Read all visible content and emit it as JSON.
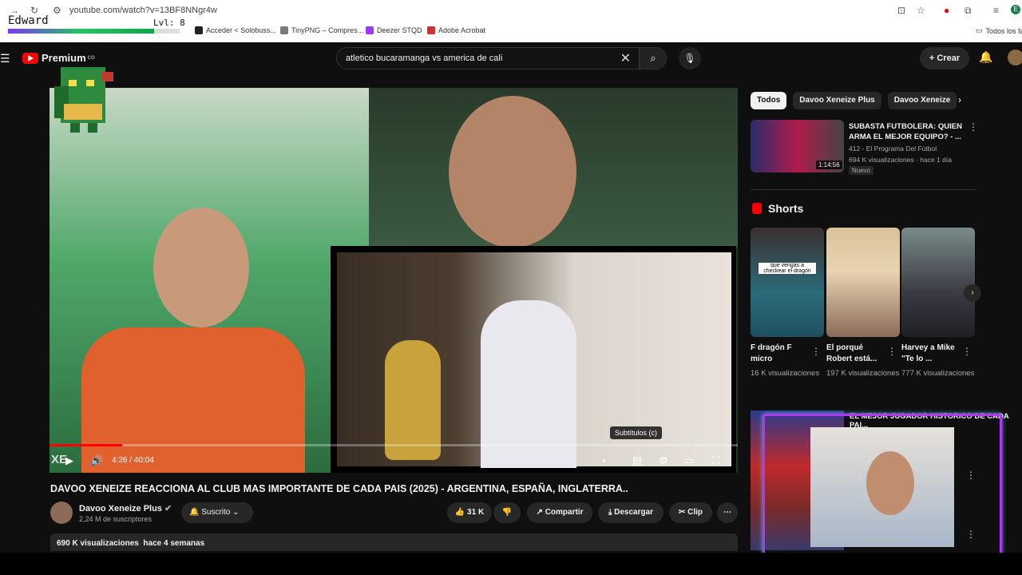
{
  "browser": {
    "url": "youtube.com/watch?v=13BF8NNgr4w",
    "bookmarks": [
      {
        "label": "Acceder < Solobuss...",
        "color": "#222222"
      },
      {
        "label": "TinyPNG – Compres...",
        "color": "#7a7a7a"
      },
      {
        "label": "Deezer STQD",
        "color": "#a238ff"
      },
      {
        "label": "Adobe Acrobat",
        "color": "#d32f2f"
      }
    ],
    "all_bookmarks": "Todos los fa"
  },
  "overlay": {
    "name": "Edward",
    "level": "Lvl: 8",
    "xp_fraction": 0.85
  },
  "header": {
    "logo": "Premium",
    "logo_sup": "CO",
    "search_value": "atletico bucaramanga vs america de cali",
    "create_label": "Crear"
  },
  "player": {
    "time": "4:26 / 40:04",
    "progress_fraction": 0.106,
    "tooltip": "Subtítulos (c)",
    "corner_text": "XE"
  },
  "video": {
    "title": "DAVOO XENEIZE REACCIONA AL CLUB MAS IMPORTANTE DE CADA PAIS (2025) - ARGENTINA, ESPAÑA, INGLATERRA..",
    "channel": "Davoo Xeneize Plus",
    "subscribers": "2,24 M de suscriptores",
    "subscribed_label": "Suscrito",
    "likes": "31 K",
    "share_label": "Compartir",
    "download_label": "Descargar",
    "clip_label": "Clip",
    "views": "690 K visualizaciones",
    "age": "hace 4 semanas"
  },
  "sidebar": {
    "chips": [
      "Todos",
      "Davoo Xeneize Plus",
      "Davoo Xeneize"
    ],
    "rec": {
      "title": "SUBASTA FUTBOLERA: QUIEN ARMA EL MEJOR EQUIPO? - ...",
      "channel": "412 - El Programa Del Fútbol",
      "meta": "694 K visualizaciones · hace 1 día",
      "badge": "Nuevo",
      "duration": "1:14:56"
    },
    "shorts_title": "Shorts",
    "shorts": [
      {
        "title": "F dragón F micro",
        "views": "16 K visualizaciones",
        "thumb": "que vengas a checkear el dragón"
      },
      {
        "title": "El porqué Robert está...",
        "views": "197 K visualizaciones"
      },
      {
        "title": "Harvey a Mike \"Te lo ...",
        "views": "777 K visualizaciones"
      }
    ],
    "next_title": "EL MEJOR JUGADOR HISTORICO DE CADA PAI..."
  }
}
